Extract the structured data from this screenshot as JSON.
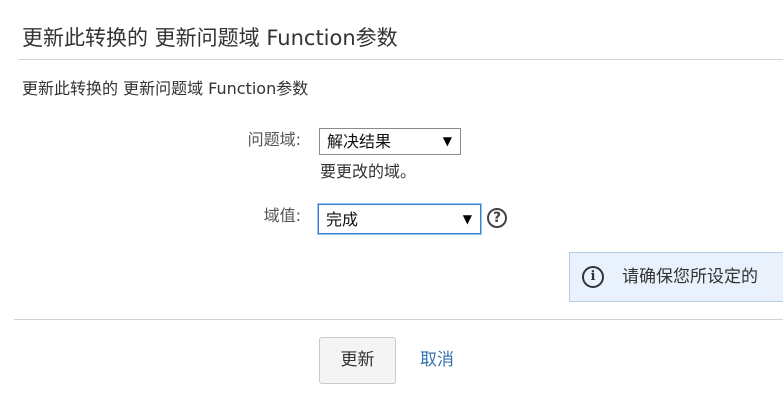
{
  "header": {
    "title": "更新此转换的 更新问题域 Function参数"
  },
  "form": {
    "description": "更新此转换的 更新问题域 Function参数",
    "issue_field": {
      "label": "问题域:",
      "selected": "解决结果",
      "help_text": "要更改的域。"
    },
    "field_value": {
      "label": "域值:",
      "selected": "完成",
      "help_icon": "question-circle-icon"
    },
    "info_message": {
      "icon": "info-circle-icon",
      "text": "请确保您所设定的"
    }
  },
  "actions": {
    "update_label": "更新",
    "cancel_label": "取消"
  },
  "icons": {
    "dropdown_arrow": "▼",
    "help_glyph": "?",
    "info_glyph": "i"
  },
  "colors": {
    "link": "#3572b0",
    "info_background": "#e9f2fc",
    "focus_border": "#3b7fd6"
  }
}
